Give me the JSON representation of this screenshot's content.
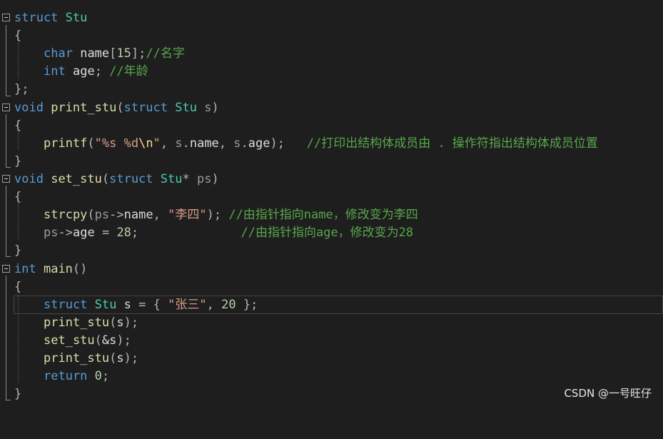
{
  "code": {
    "l1": {
      "kw": "struct",
      "name": "Stu"
    },
    "l2": {
      "brace": "{"
    },
    "l3": {
      "type": "char",
      "var": "name",
      "br_open": "[",
      "num": "15",
      "br_close": "]",
      "semi": ";",
      "comment": "//名字"
    },
    "l4": {
      "type": "int",
      "var": "age",
      "semi": ";",
      "comment": "//年龄"
    },
    "l5": {
      "brace": "};"
    },
    "l6": {
      "ret": "void",
      "fn": "print_stu",
      "p_open": "(",
      "kw": "struct",
      "type": "Stu",
      "param": "s",
      "p_close": ")"
    },
    "l7": {
      "brace": "{"
    },
    "l8": {
      "fn": "printf",
      "p_open": "(",
      "q1": "\"",
      "fmt1": "%s %d",
      "esc": "\\n",
      "q2": "\"",
      "comma1": ",",
      "a1": "s",
      "dot1": ".",
      "m1": "name",
      "comma2": ",",
      "a2": "s",
      "dot2": ".",
      "m2": "age",
      "p_close": ")",
      "semi": ";",
      "comment": "//打印出结构体成员由 . 操作符指出结构体成员位置"
    },
    "l9": {
      "brace": "}"
    },
    "l10": {
      "ret": "void",
      "fn": "set_stu",
      "p_open": "(",
      "kw": "struct",
      "type": "Stu",
      "star": "*",
      "param": "ps",
      "p_close": ")"
    },
    "l11": {
      "brace": "{"
    },
    "l12": {
      "fn": "strcpy",
      "p_open": "(",
      "a1": "ps",
      "arrow": "->",
      "m1": "name",
      "comma": ",",
      "str": "\"李四\"",
      "p_close": ")",
      "semi": ";",
      "comment": "//由指针指向name，修改变为李四"
    },
    "l13": {
      "a1": "ps",
      "arrow": "->",
      "m1": "age",
      "eq": "=",
      "num": "28",
      "semi": ";",
      "comment": "//由指针指向age，修改变为28"
    },
    "l14": {
      "brace": "}"
    },
    "l15": {
      "ret": "int",
      "fn": "main",
      "parens": "()"
    },
    "l16": {
      "brace": "{"
    },
    "l17": {
      "kw": "struct",
      "type": "Stu",
      "var": "s",
      "eq": "=",
      "b_open": "{",
      "str": "\"张三\"",
      "comma": ",",
      "num": "20",
      "b_close": "}",
      "semi": ";"
    },
    "l18": {
      "fn": "print_stu",
      "p_open": "(",
      "arg": "s",
      "p_close": ")",
      "semi": ";"
    },
    "l19": {
      "fn": "set_stu",
      "p_open": "(",
      "arg": "&s",
      "p_close": ")",
      "semi": ";"
    },
    "l20": {
      "fn": "print_stu",
      "p_open": "(",
      "arg": "s",
      "p_close": ")",
      "semi": ";"
    },
    "l21": {
      "kw": "return",
      "num": "0",
      "semi": ";"
    },
    "l22": {
      "brace": "}"
    }
  },
  "watermark": "CSDN @一号旺仔",
  "icons": {
    "fold": "fold-minus-icon"
  },
  "colors": {
    "background": "#1e1e1e",
    "keyword": "#569cd6",
    "type": "#4ec9b0",
    "function": "#dcdcaa",
    "string": "#d69d85",
    "comment": "#57a64a",
    "number": "#b5cea8"
  }
}
